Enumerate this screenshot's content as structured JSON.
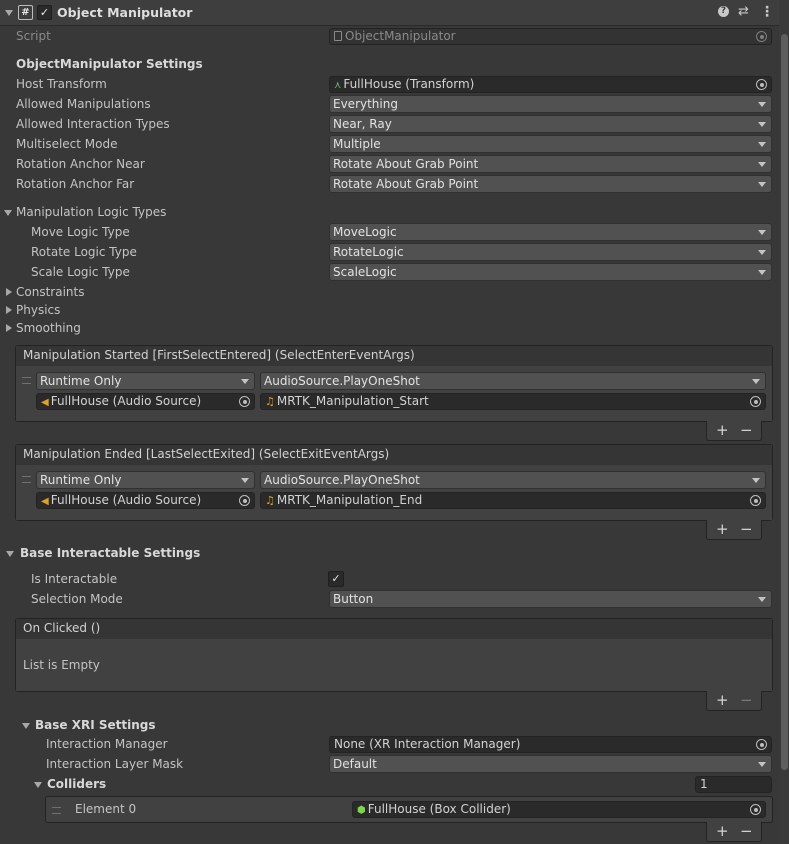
{
  "header": {
    "title": "Object Manipulator",
    "enabled": true
  },
  "script": {
    "label": "Script",
    "value": "ObjectManipulator"
  },
  "settings": {
    "heading": "ObjectManipulator Settings",
    "rows": [
      {
        "label": "Host Transform",
        "value": "FullHouse (Transform)"
      },
      {
        "label": "Allowed Manipulations",
        "value": "Everything"
      },
      {
        "label": "Allowed Interaction Types",
        "value": "Near, Ray"
      },
      {
        "label": "Multiselect Mode",
        "value": "Multiple"
      },
      {
        "label": "Rotation Anchor Near",
        "value": "Rotate About Grab Point"
      },
      {
        "label": "Rotation Anchor Far",
        "value": "Rotate About Grab Point"
      }
    ]
  },
  "logic": {
    "heading": "Manipulation Logic Types",
    "rows": [
      {
        "label": "Move Logic Type",
        "value": "MoveLogic"
      },
      {
        "label": "Rotate Logic Type",
        "value": "RotateLogic"
      },
      {
        "label": "Scale Logic Type",
        "value": "ScaleLogic"
      }
    ]
  },
  "foldouts": [
    "Constraints",
    "Physics",
    "Smoothing"
  ],
  "events": [
    {
      "title": "Manipulation Started [FirstSelectEntered] (SelectEnterEventArgs)",
      "mode": "Runtime Only",
      "function": "AudioSource.PlayOneShot",
      "target": "FullHouse (Audio Source)",
      "argument": "MRTK_Manipulation_Start"
    },
    {
      "title": "Manipulation Ended [LastSelectExited] (SelectExitEventArgs)",
      "mode": "Runtime Only",
      "function": "AudioSource.PlayOneShot",
      "target": "FullHouse (Audio Source)",
      "argument": "MRTK_Manipulation_End"
    }
  ],
  "base": {
    "heading": "Base Interactable Settings",
    "is_interactable_label": "Is Interactable",
    "is_interactable": true,
    "selection_mode_label": "Selection Mode",
    "selection_mode": "Button",
    "on_clicked_title": "On Clicked ()",
    "on_clicked_empty": "List is Empty"
  },
  "xri": {
    "heading": "Base XRI Settings",
    "manager_label": "Interaction Manager",
    "manager_value": "None (XR Interaction Manager)",
    "layer_label": "Interaction Layer Mask",
    "layer_value": "Default",
    "colliders_label": "Colliders",
    "colliders_count": "1",
    "element_label": "Element 0",
    "element_value": "FullHouse (Box Collider)"
  },
  "plus": "+",
  "minus": "−"
}
